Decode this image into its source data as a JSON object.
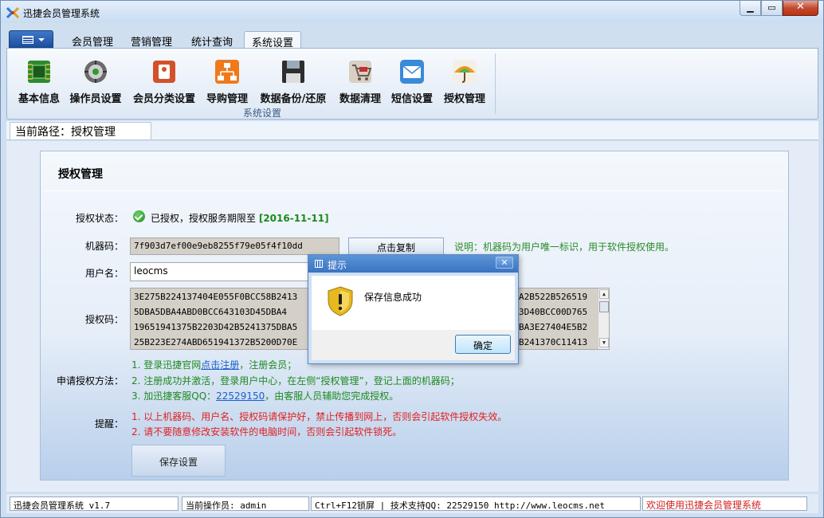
{
  "window": {
    "title": "迅捷会员管理系统"
  },
  "ribbon": {
    "tabs": [
      {
        "label": "会员管理"
      },
      {
        "label": "营销管理"
      },
      {
        "label": "统计查询"
      },
      {
        "label": "系统设置"
      }
    ],
    "active_tab": "系统设置",
    "items": [
      {
        "label": "基本信息",
        "icon": "circuit-board-icon",
        "color": "#2d8a2d"
      },
      {
        "label": "操作员设置",
        "icon": "gear-dial-icon",
        "color": "#555555"
      },
      {
        "label": "会员分类设置",
        "icon": "tag-settings-icon",
        "color": "#c84420"
      },
      {
        "label": "导购管理",
        "icon": "org-chart-icon",
        "color": "#e8761c"
      },
      {
        "label": "数据备份/还原",
        "icon": "floppy-disk-icon",
        "color": "#333333"
      },
      {
        "label": "数据清理",
        "icon": "cart-icon",
        "color": "#9a8a78"
      },
      {
        "label": "短信设置",
        "icon": "envelope-icon",
        "color": "#3a8ad8"
      },
      {
        "label": "授权管理",
        "icon": "umbrella-icon",
        "color": "#e8a030"
      }
    ],
    "group_label": "系统设置"
  },
  "path": {
    "label": "当前路径：授权管理"
  },
  "panel": {
    "title": "授权管理",
    "status_label": "授权状态：",
    "status_text": "已授权，授权服务期限至",
    "status_date": "[2016-11-11]",
    "machine_label": "机器码：",
    "machine_code": "7f903d7ef00e9eb8255f79e05f4f10dd",
    "copy_button": "点击复制",
    "machine_note": "说明：机器码为用户唯一标识，用于软件授权使用。",
    "username_label": "用户名：",
    "username": "leocms",
    "auth_label": "授权码：",
    "auth_lines": [
      "3E275B224137404E055F0BCC58B2413",
      "5DBA5DBA4ABD0BCC643103D45DBA4",
      "19651941375B2203D42B5241375DBA5",
      "25B223E274ABD651941372B5200D70E"
    ],
    "auth_lines_right": [
      "A2B522B526519",
      "3D40BCC00D765",
      "BA3E27404E5B2",
      "B241370C11413"
    ],
    "apply_label": "申请授权方法：",
    "steps": [
      {
        "pre": "1. 登录迅捷官网",
        "link": "点击注册",
        "post": "，注册会员；"
      },
      {
        "pre": "2. 注册成功并激活，登录用户中心，在左侧“授权管理”，登记上面的机器码；",
        "link": "",
        "post": ""
      },
      {
        "pre": "3. 加迅捷客服QQ：",
        "link": "22529150",
        "post": "，由客服人员辅助您完成授权。"
      }
    ],
    "remind_label": "提醒：",
    "warnings": [
      "1. 以上机器码、用户名、授权码请保护好，禁止传播到网上，否则会引起软件授权失效。",
      "2. 请不要随意修改安装软件的电脑时间，否则会引起软件锁死。"
    ],
    "save_button": "保存设置"
  },
  "dialog": {
    "title": "提示",
    "message": "保存信息成功",
    "ok_button": "确定",
    "icon": "warning-shield-icon"
  },
  "statusbar": {
    "app_version": "迅捷会员管理系统 v1.7",
    "operator": "当前操作员: admin",
    "support": "Ctrl+F12锁屏 | 技术支持QQ:  22529150       http://www.leocms.net",
    "welcome": "欢迎使用迅捷会员管理系统"
  }
}
